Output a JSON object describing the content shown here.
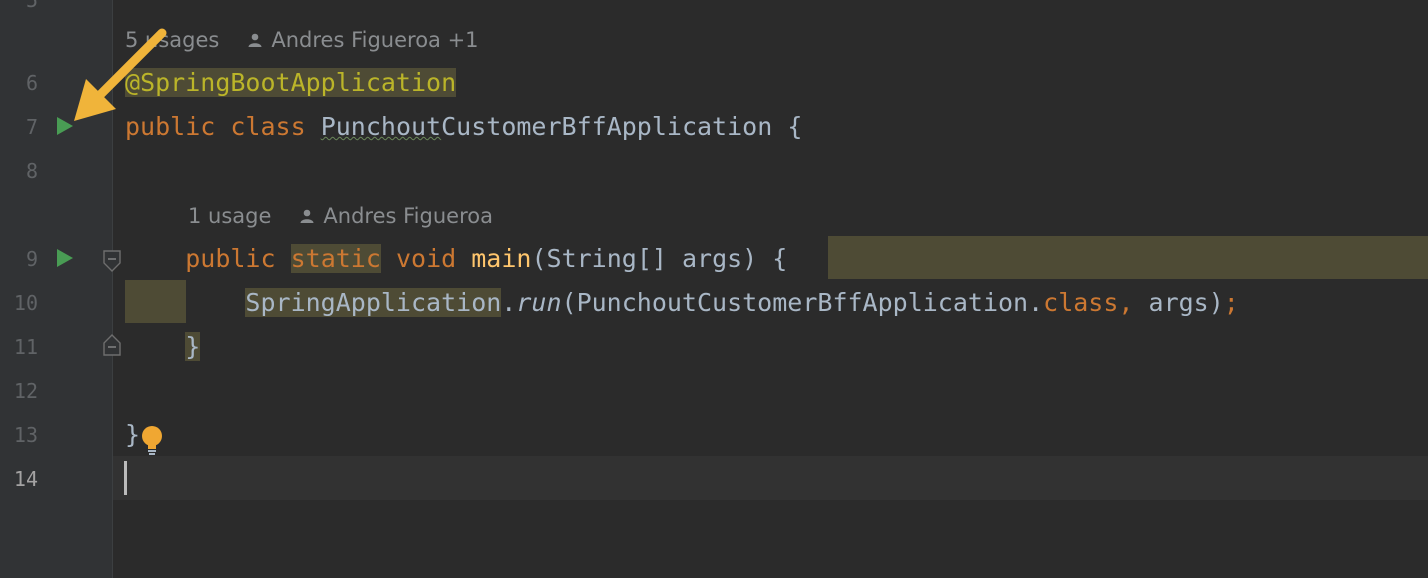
{
  "gutter": {
    "line_numbers": [
      "6",
      "7",
      "8",
      "9",
      "10",
      "11",
      "12",
      "13",
      "14"
    ]
  },
  "hints": {
    "class_usages": "5 usages",
    "class_author": "Andres Figueroa +1",
    "method_usages": "1 usage",
    "method_author": "Andres Figueroa"
  },
  "code": {
    "line5_at": "@",
    "line5_annotation": "SpringBootApplication",
    "line6_public": "public",
    "line6_class": "class",
    "line6_name_a": "Punchout",
    "line6_name_b": "CustomerBffApplication",
    "line6_brace": " {",
    "line8_public": "public",
    "line8_static": "static",
    "line8_void": "void",
    "line8_main": "main",
    "line8_params": "(String[] args) {",
    "line9_class": "SpringApplication",
    "line9_dot": ".",
    "line9_run": "run",
    "line9_arg": "(PunchoutCustomerBffApplication.",
    "line9_classkw": "class,",
    "line9_args": " args)",
    "line9_semi": ";",
    "line10_brace": "}",
    "line12_brace": "}"
  },
  "icons": {
    "run": "run-gutter-icon",
    "fold": "fold-marker-icon",
    "bulb": "intention-bulb-icon",
    "arrow": "annotation-arrow-icon",
    "person": "author-icon"
  },
  "colors": {
    "background": "#2b2b2b",
    "keyword": "#cc7832",
    "annotation": "#bbb529",
    "function": "#ffc66d",
    "text": "#a9b7c6",
    "run_green": "#499c54",
    "arrow": "#f0b43a"
  }
}
